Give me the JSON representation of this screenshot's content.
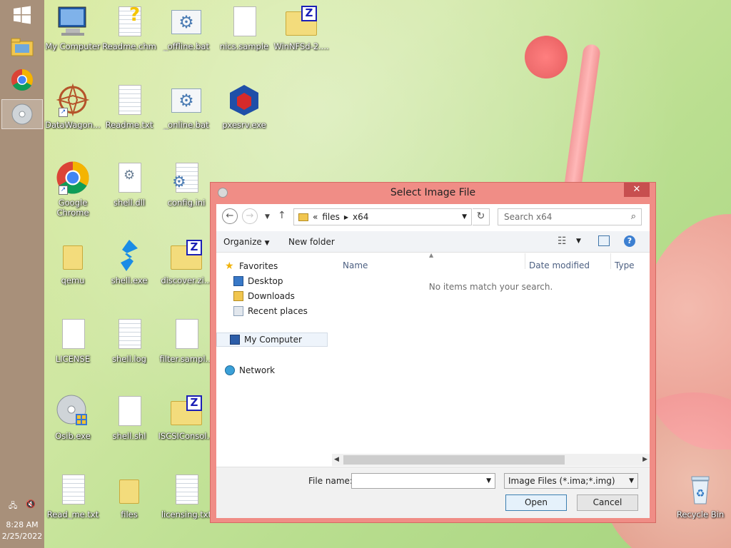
{
  "taskbar": {
    "time": "8:28 AM",
    "date": "2/25/2022"
  },
  "desktop": {
    "icons": [
      {
        "label": "My Computer"
      },
      {
        "label": "Readme.chm"
      },
      {
        "label": "_offline.bat"
      },
      {
        "label": "nics.sample"
      },
      {
        "label": "WinNFSd-2...."
      },
      {
        "label": "DataWagon..."
      },
      {
        "label": "Readme.txt"
      },
      {
        "label": "_online.bat"
      },
      {
        "label": "pxesrv.exe"
      },
      {
        "label": "Google Chrome"
      },
      {
        "label": "shell.dll"
      },
      {
        "label": "config.ini"
      },
      {
        "label": "qemu"
      },
      {
        "label": "shell.exe"
      },
      {
        "label": "discover.zi..."
      },
      {
        "label": "LICENSE"
      },
      {
        "label": "shell.log"
      },
      {
        "label": "filter.sampl..."
      },
      {
        "label": "Osib.exe"
      },
      {
        "label": "shell.shl"
      },
      {
        "label": "ISCSIConsol..."
      },
      {
        "label": "Read_me.txt"
      },
      {
        "label": "files"
      },
      {
        "label": "licensing.txt"
      },
      {
        "label": "Recycle Bin"
      }
    ]
  },
  "dialog": {
    "title": "Select Image File",
    "close": "✕",
    "breadcrumb": {
      "prefix": "«",
      "part1": "files",
      "part2": "x64"
    },
    "search_placeholder": "Search x64",
    "toolbar": {
      "organize": "Organize",
      "new_folder": "New folder"
    },
    "nav_pane": {
      "favorites": "Favorites",
      "desktop": "Desktop",
      "downloads": "Downloads",
      "recent": "Recent places",
      "my_computer": "My Computer",
      "network": "Network"
    },
    "columns": {
      "name": "Name",
      "date": "Date modified",
      "type": "Type"
    },
    "empty_message": "No items match your search.",
    "file_name_label": "File name:",
    "file_name_value": "",
    "filter_value": "Image Files (*.ima;*.img)",
    "open_label": "Open",
    "cancel_label": "Cancel"
  },
  "colors": {
    "taskbar": "#a8907a",
    "dialog_border": "#f08d86",
    "close_button": "#c74f4f"
  }
}
